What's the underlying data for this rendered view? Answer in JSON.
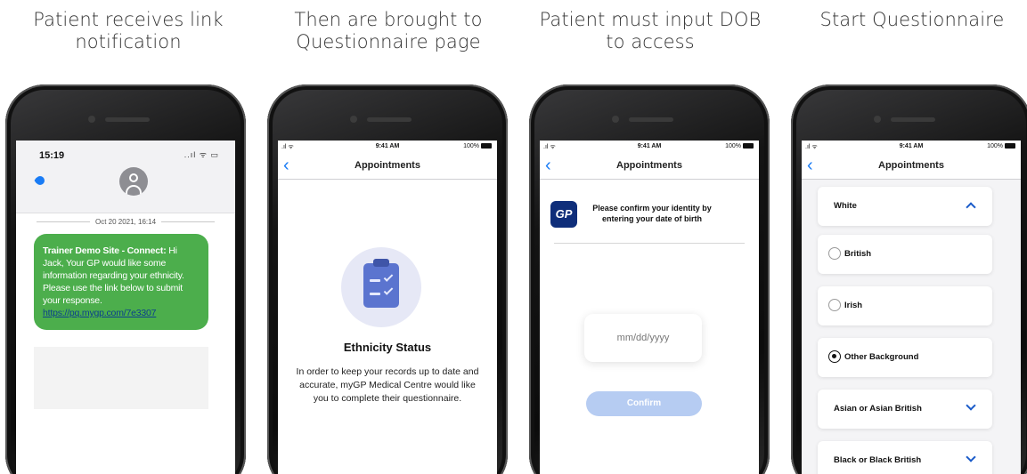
{
  "captions": {
    "step1": "Patient receives link notification",
    "step2": "Then are brought to Questionnaire page",
    "step3": "Patient must input DOB to access",
    "step4": "Start Questionnaire"
  },
  "sms": {
    "time": "15:19",
    "status": "..ıl ᯤ ▭",
    "date": "Oct 20 2021, 16:14",
    "sender": "Trainer Demo Site - Connect:",
    "message": "Hi Jack, Your GP would like some information regarding your ethnicity. Please use the link below to submit your response.",
    "link": "https://pq.mygp.com/7e3307"
  },
  "app": {
    "clock": "9:41 AM",
    "battery": "100%",
    "title": "Appointments"
  },
  "intro": {
    "heading": "Ethnicity Status",
    "body": "In order to keep your records up to date and accurate, myGP Medical Centre would like you to complete their questionnaire."
  },
  "dob": {
    "logo": "GP",
    "message": "Please confirm your identity by entering your date of birth",
    "placeholder": "mm/dd/yyyy",
    "confirm": "Confirm"
  },
  "questionnaire": {
    "group_open": "White",
    "options": [
      {
        "label": "British",
        "selected": false
      },
      {
        "label": "Irish",
        "selected": false
      },
      {
        "label": "Other Background",
        "selected": true
      }
    ],
    "group_2": "Asian or Asian British",
    "group_3": "Black or Black British"
  },
  "colors": {
    "sms_bubble": "#4cae4c",
    "ios_blue": "#1a7cf5",
    "brand_navy": "#0f2e7a",
    "confirm_disabled": "#b6ccf2"
  }
}
